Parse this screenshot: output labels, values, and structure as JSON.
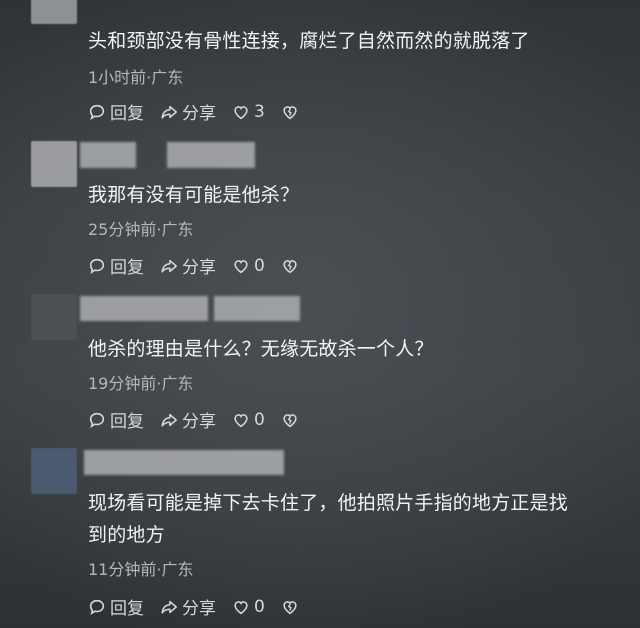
{
  "comments": [
    {
      "text": "头和颈部没有骨性连接，腐烂了自然而然的就脱落了",
      "meta": "1小时前·广东",
      "reply": "回复",
      "share": "分享",
      "likes": "3"
    },
    {
      "text": "我那有没有可能是他杀？",
      "meta": "25分钟前·广东",
      "reply": "回复",
      "share": "分享",
      "likes": "0"
    },
    {
      "text": "他杀的理由是什么？无缘无故杀一个人？",
      "meta": "19分钟前·广东",
      "reply": "回复",
      "share": "分享",
      "likes": "0"
    },
    {
      "text_line1": "现场看可能是掉下去卡住了，他拍照片手指的地方正是找",
      "text_line2": "到的地方",
      "meta": "11分钟前·广东",
      "reply": "回复",
      "share": "分享",
      "likes": "0"
    }
  ],
  "icons": {
    "reply": "reply-bubble-icon",
    "share": "share-arrow-icon",
    "like": "heart-icon",
    "dislike": "broken-heart-icon"
  }
}
